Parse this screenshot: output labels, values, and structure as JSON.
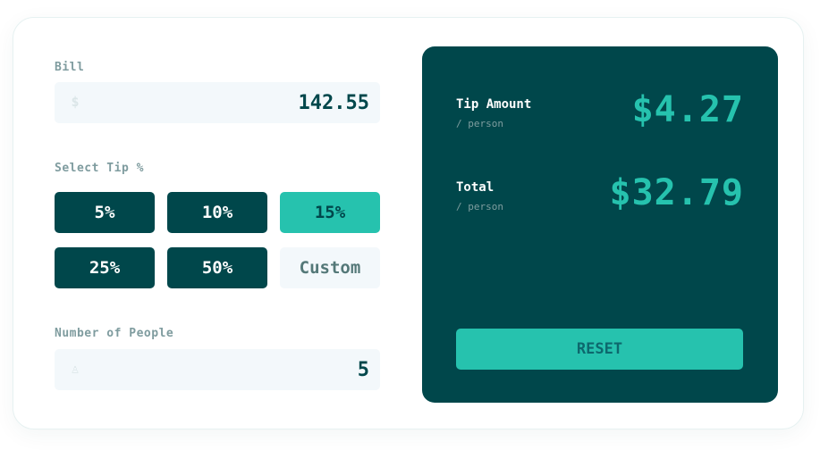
{
  "bill": {
    "label": "Bill",
    "icon": "dollar-icon",
    "icon_glyph": "$",
    "value": "142.55"
  },
  "tip": {
    "label": "Select Tip %",
    "options": [
      "5%",
      "10%",
      "15%",
      "25%",
      "50%"
    ],
    "selected": "15%",
    "custom_label": "Custom"
  },
  "people": {
    "label": "Number of People",
    "icon": "person-icon",
    "icon_glyph": "♙",
    "value": "5"
  },
  "results": {
    "tip_title": "Tip Amount",
    "tip_sub": "/ person",
    "tip_value": "$4.27",
    "total_title": "Total",
    "total_sub": "/ person",
    "total_value": "$32.79"
  },
  "reset_label": "RESET",
  "colors": {
    "dark_teal": "#00474b",
    "accent": "#26c2ae",
    "input_bg": "#f3f8fb",
    "label": "#7f9c9f"
  }
}
